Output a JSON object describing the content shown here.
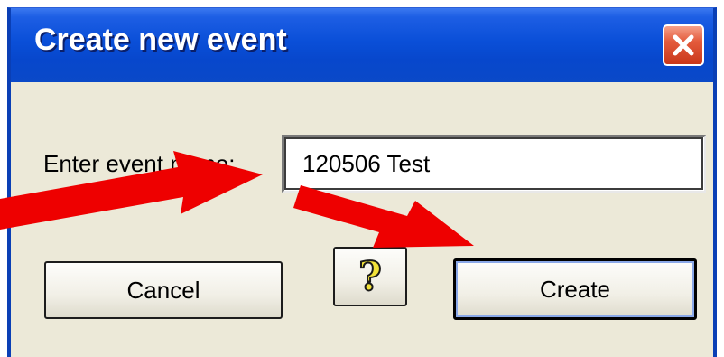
{
  "dialog": {
    "title": "Create new event",
    "label": "Enter event name:",
    "input_value": "120506 Test",
    "buttons": {
      "cancel": "Cancel",
      "help": "?",
      "create": "Create"
    }
  },
  "icons": {
    "close": "close-icon",
    "help": "question-mark-icon",
    "annotation": "arrow-icon"
  },
  "colors": {
    "titlebar": "#0a4fd8",
    "dialog_bg": "#ece9d8",
    "close_button": "#e45b3c",
    "annotation_arrow": "#ee0000",
    "help_glyph": "#f2e23a"
  }
}
